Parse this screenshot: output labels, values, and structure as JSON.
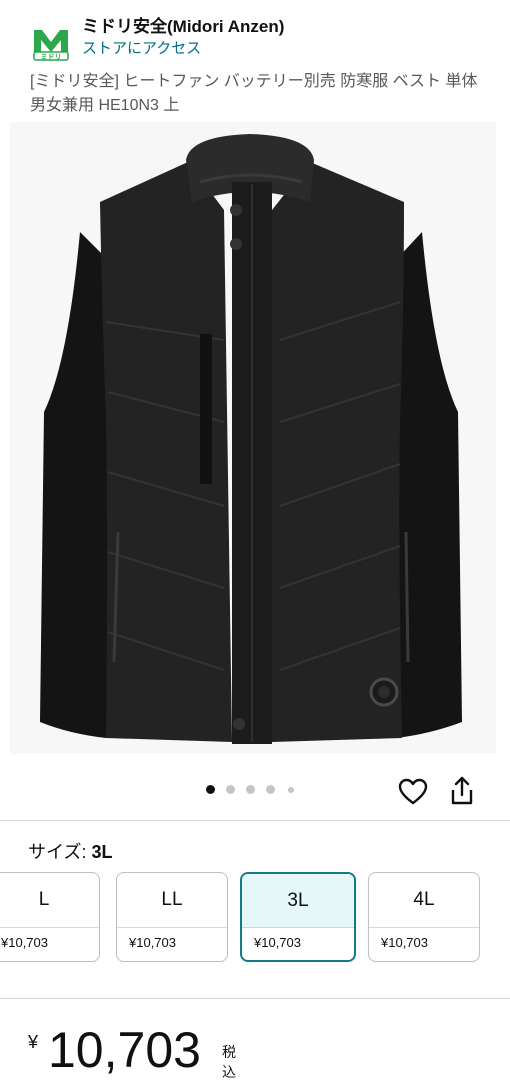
{
  "store": {
    "name": "ミドリ安全(Midori Anzen)",
    "link": "ストアにアクセス",
    "logo_letter": "M",
    "logo_subtext": "ミドリ"
  },
  "product": {
    "title": "[ミドリ安全] ヒートファン バッテリー別売 防寒服 ベスト 単体 男女兼用 HE10N3 上"
  },
  "gallery": {
    "total_images": 5,
    "active_index": 0
  },
  "actions": {
    "favorite_icon": "heart-icon",
    "share_icon": "share-icon"
  },
  "size": {
    "label": "サイズ:",
    "selected": "3L",
    "options": [
      {
        "label": "L",
        "price": "¥10,703"
      },
      {
        "label": "LL",
        "price": "¥10,703"
      },
      {
        "label": "3L",
        "price": "¥10,703"
      },
      {
        "label": "4L",
        "price": "¥10,703"
      }
    ]
  },
  "price": {
    "currency": "¥",
    "value": "10,703",
    "tax_note": "税込"
  },
  "colors": {
    "accent": "#147a86",
    "link": "#007185",
    "brand_green": "#2aa84a"
  }
}
